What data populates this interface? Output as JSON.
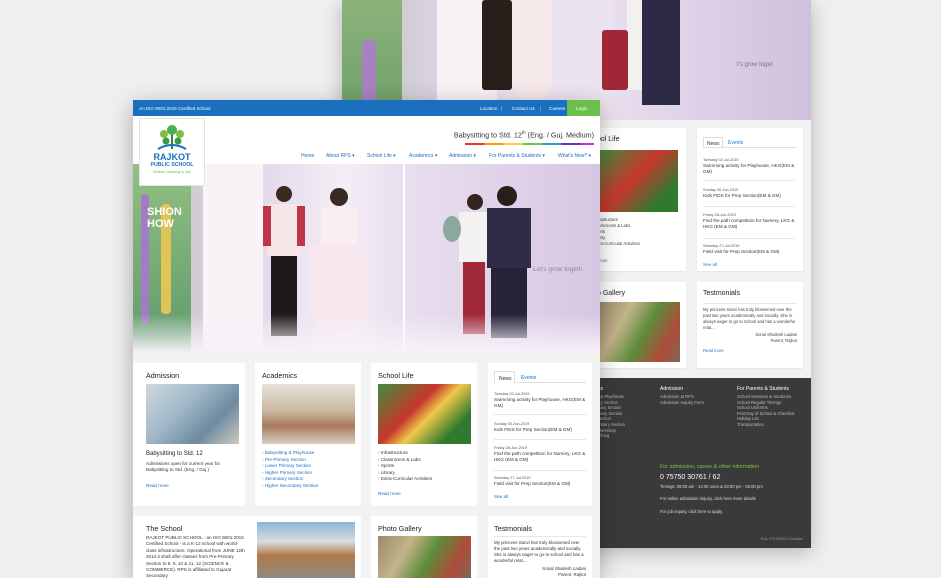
{
  "back": {
    "school_life": {
      "title": "ool Life",
      "items": [
        "rastructure",
        "assrooms & Labs",
        "orts",
        "rary",
        "tra-Curricular Activities"
      ],
      "read_more": "more"
    },
    "news_tabs": [
      "News",
      "Events"
    ],
    "news": [
      {
        "date": "Tuesday 02-Jul-2019",
        "text": "Swimming activity for Playhouse, HKG(EM & GM)"
      },
      {
        "date": "Sunday 30-Jun-2019",
        "text": "Kids FIDS for Prep Section(EM & GM)"
      },
      {
        "date": "Friday 28-Jun-2019",
        "text": "Find the path competition for Nursery, LKG & HKG (EM & GM)"
      },
      {
        "date": "Saturday 27-Jul-2019",
        "text": "Field visit for Prep Section(EM & GM)"
      }
    ],
    "see_all": "See all",
    "photo_gallery": "o Gallery",
    "testimonials": {
      "title": "Testmonials",
      "text": "My princess Sanvi has truly blossomed over the past two years academically and socially. She is always eager to go to school and has a wonderful relat...",
      "author": "Sonal Shailesh Ladani",
      "role": "Parent, Rajkot",
      "read_more": "Read more"
    },
    "footer": {
      "col1_title": "ics",
      "col1": [
        "a & Playhouse",
        "ary Section",
        "mary Section",
        "imary Section",
        "Section",
        "ondary Section",
        "Workshop",
        "aching"
      ],
      "col2_title": "Admission",
      "col2": [
        "Admission at RPS",
        "Admission Inquiry Form"
      ],
      "col3_title": "For Parents & Students",
      "col3": [
        "School Sessions & Vacations",
        "School Regular Timings",
        "School Uniforms",
        "First Day of School & Checklist",
        "Holiday List",
        "Transportation"
      ],
      "contact_title": "For admission, career & other information",
      "phone": "0 75750 30761 / 62",
      "timings": "Timings: 09:00 am - 12:00 noon  &  03:00 pm - 05:00 pm",
      "inquiry": "For online admission inquiry, click here more details",
      "job": "For job inquiry, click here to apply.",
      "credit": "RAL STUDIOS Creative"
    }
  },
  "front": {
    "topbar": {
      "cert": "An ISO 9001:2015 Certified School",
      "location": "Location",
      "contact": "Contact Us",
      "careers": "Careers",
      "login": "Login"
    },
    "logo": {
      "line1": "RAJKOT",
      "line2": "PUBLIC SCHOOL",
      "tagline": "Where Learning is Joy"
    },
    "headline_prefix": "Babysitting to Std. 12",
    "headline_sup": "th",
    "headline_suffix": " (Eng. / Guj. Medium)",
    "nav": [
      "Home",
      "About RPS ▾",
      "School Life ▾",
      "Academics ▾",
      "Admission ▾",
      "For Parents & Students ▾",
      "What's New? ▾"
    ],
    "admission": {
      "title": "Admission",
      "subtitle": "Babysitting to Std. 12",
      "text": "Admissions open for current year for Babysitting to Std. (Eng. / Guj.)",
      "read_more": "Read more"
    },
    "academics": {
      "title": "Academics",
      "items": [
        "Babysitting & Playhouse",
        "Pre-Primary Section",
        "Lower Primary Section",
        "Higher Primary Section",
        "Secondary Section",
        "Higher Secondary Section"
      ]
    },
    "school_life": {
      "title": "School Life",
      "items": [
        "Infrastructure",
        "Classrooms & Labs",
        "Sports",
        "Library",
        "Extra-Curricular Activities"
      ],
      "read_more": "Read more"
    },
    "news_tabs": [
      "News",
      "Events"
    ],
    "news": [
      {
        "date": "Tuesday 02-Jul-2019",
        "text": "Swimming activity for Playhouse, HKG(EM & GM)"
      },
      {
        "date": "Sunday 30-Jun-2019",
        "text": "Kids FIDS for Prep Section(EM & GM)"
      },
      {
        "date": "Friday 28-Jun-2019",
        "text": "Find the path competition for Nursery, LKG & HKG (EM & GM)"
      },
      {
        "date": "Saturday 27-Jul-2019",
        "text": "Field visit for Prep Section(EM & GM)"
      }
    ],
    "see_all": "See all",
    "the_school": {
      "title": "The School",
      "text": "RAJKOT PUBLIC SCHOOL - an ISO 9001:2015 Certified School - is a K-12 school with world-class infrastructure. Operational from JUNE 12th 2014 it shall offer classes from Pre-Primary Section to 8, 9, 10 & 11, 12 (SCIENCE & COMMERCE). RPS is affiliated to Gujarat Secondary"
    },
    "photo_gallery": "Photo Gallery",
    "testimonials": {
      "title": "Testmonials",
      "text": "My princess Sanvi has truly blossomed over the past two years academically and socially. She is always eager to go to school and has a wonderful relat...",
      "author": "Sonal Shailesh Ladani",
      "role": "Parent, Rajkot"
    }
  },
  "colors": {
    "blue": "#1a6fbe",
    "green": "#6cc04a",
    "dark": "#3a3a3a"
  }
}
